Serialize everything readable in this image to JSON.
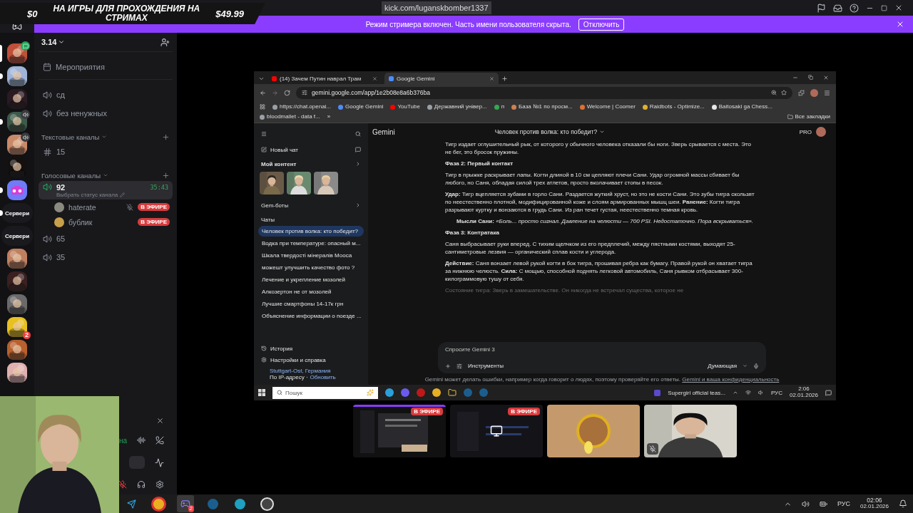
{
  "stream_overlay": {
    "left_amount": "$0",
    "title": "НА ИГРЫ ДЛЯ ПРОХОЖДЕНИЯ НА СТРИМАХ",
    "right_amount": "$49.99"
  },
  "window_url": "kick.com/luganskbomber1337",
  "streamer_banner": {
    "text": "Режим стримера включен. Часть имени пользователя скрыта.",
    "button": "Отключить"
  },
  "servers": [
    {
      "kind": "picture",
      "color": "#c0503a",
      "selected": true,
      "unread": false,
      "voice_active": false,
      "new_messages": true
    },
    {
      "kind": "picture",
      "color": "#9fb4d8",
      "selected": false,
      "unread": true,
      "voice_active": false,
      "new_messages": false
    },
    {
      "kind": "picture",
      "color": "#2a1a22",
      "selected": false,
      "unread": false,
      "voice_active": false,
      "new_messages": false
    },
    {
      "kind": "picture",
      "color": "#3d5a4a",
      "selected": false,
      "unread": true,
      "voice_active": true,
      "new_messages": false
    },
    {
      "kind": "picture",
      "color": "#c98a6a",
      "selected": false,
      "unread": false,
      "voice_active": true,
      "new_messages": false
    },
    {
      "kind": "picture",
      "color": "#151010",
      "selected": false,
      "unread": false,
      "voice_active": false,
      "new_messages": false
    },
    {
      "kind": "boombox",
      "color": "#6f7bf7",
      "selected": false,
      "unread": true,
      "voice_active": false,
      "new_messages": false
    },
    {
      "kind": "folder",
      "label": "Сервери",
      "selected": false,
      "unread": true,
      "voice_active": false,
      "new_messages": false
    },
    {
      "kind": "folder",
      "label": "Сервери",
      "selected": false,
      "unread": false,
      "voice_active": false,
      "new_messages": false
    },
    {
      "kind": "picture",
      "color": "#c08060",
      "selected": false,
      "unread": false,
      "voice_active": false,
      "new_messages": false
    },
    {
      "kind": "picture",
      "color": "#3a2020",
      "selected": false,
      "unread": false,
      "voice_active": false,
      "new_messages": false
    },
    {
      "kind": "picture",
      "color": "#6a6a6a",
      "selected": false,
      "unread": false,
      "voice_active": false,
      "new_messages": false
    },
    {
      "kind": "picture",
      "color": "#e8c020",
      "selected": false,
      "unread": false,
      "voice_active": false,
      "new_messages": false,
      "mentions": "2"
    },
    {
      "kind": "picture",
      "color": "#b8602e",
      "selected": false,
      "unread": false,
      "voice_active": false,
      "new_messages": false
    },
    {
      "kind": "picture",
      "color": "#e0b0b0",
      "selected": false,
      "unread": false,
      "voice_active": false,
      "new_messages": false
    }
  ],
  "server_name": "3.14",
  "events": "Мероприятия",
  "top_channels": [
    {
      "kind": "voice",
      "name": "сд",
      "selected": false
    },
    {
      "kind": "voice",
      "name": "без ненужных",
      "selected": false
    }
  ],
  "categories": [
    {
      "name": "Текстовые каналы",
      "channels": [
        {
          "kind": "text",
          "name": "15",
          "selected": false
        }
      ]
    },
    {
      "name": "Голосовые каналы",
      "channels": [
        {
          "kind": "voice",
          "name": "92",
          "selected": true,
          "timer": "35:43",
          "status": "Выбрать статус канала",
          "members": [
            {
              "name": "haterate",
              "muted": true,
              "live": "В ЭФИРЕ"
            },
            {
              "name": "бублик",
              "muted": false,
              "live": "В ЭФИРЕ"
            }
          ]
        },
        {
          "kind": "voice",
          "name": "65",
          "selected": false
        },
        {
          "kind": "voice",
          "name": "35",
          "selected": false
        }
      ]
    }
  ],
  "voice_panel": {
    "status_fragment": "на",
    "mic_muted": true
  },
  "browser": {
    "tabs": [
      {
        "title": "(14) Зачем Путин наврал Трам",
        "color": "#ff0000",
        "selected": false
      },
      {
        "title": "Google Gemini",
        "color": "#4e8cf7",
        "selected": true
      }
    ],
    "url": "gemini.google.com/app/1e2b08e8a6b376ba",
    "bookmarks": [
      {
        "label": "https://chat.openai...",
        "color": "#9aa0a6"
      },
      {
        "label": "Google Gemini",
        "color": "#4e8cf7"
      },
      {
        "label": "YouTube",
        "color": "#ff0000"
      },
      {
        "label": "Державний універ...",
        "color": "#9aa0a6"
      },
      {
        "label": "п",
        "color": "#34a853"
      },
      {
        "label": "База №1 по просм...",
        "color": "#d08050"
      },
      {
        "label": "Welcome | Coomer",
        "color": "#e07030"
      },
      {
        "label": "Raidbots - Optimize...",
        "color": "#e0b030"
      },
      {
        "label": "Baitosaki ga Chess...",
        "color": "#e8e8e8"
      },
      {
        "label": "bloodmallet - data f...",
        "color": "#9aa0a6"
      }
    ],
    "more_bookmarks": "»",
    "all_bookmarks": "Все закладки"
  },
  "gemini": {
    "brand": "Gemini",
    "new_chat": "Новый чат",
    "my_content": "Мой контент",
    "gems": "Gem-боты",
    "chats_heading": "Чаты",
    "chats": [
      {
        "title": "Человек против волка: кто победит?",
        "selected": true
      },
      {
        "title": "Водка при температуре: опасный м...",
        "selected": false
      },
      {
        "title": "Шкала твердості мінералів Мооса",
        "selected": false
      },
      {
        "title": "можешт улучшить качество фото ?",
        "selected": false
      },
      {
        "title": "Лечение и укрепление мозолей",
        "selected": false
      },
      {
        "title": "Алкозертон не от мозолей",
        "selected": false
      },
      {
        "title": "Лучшие смартфоны 14-17к грн",
        "selected": false
      },
      {
        "title": "Объяснение информации о поезде ...",
        "selected": false
      }
    ],
    "history": "История",
    "settings": "Настройки и справка",
    "location": {
      "place": "Stuttgart-Ost, Германия",
      "source": "По IP-адресу ·",
      "action": "Обновить"
    },
    "chat_title": "Человек против волка: кто победит?",
    "plan": "PRO",
    "blocks": [
      {
        "kind": "paragraph",
        "text": "Тигр издает оглушительный рык, от которого у обычного человека отказали бы ноги. Зверь срывается с места. Это не бег, это бросок пружины."
      },
      {
        "kind": "heading",
        "text": "Фаза 2: Первый контакт"
      },
      {
        "kind": "paragraph",
        "text": "Тигр в прыжке раскрывает лапы. Когти длиной в 10 см цепляют плечи Сани. Удар огромной массы сбивает бы любого, но Саня, обладая силой трех атлетов, просто вколачивает стопы в песок."
      },
      {
        "kind": "paragraph",
        "text": "**Удар:** Тигр вцепляется зубами в горло Сани. Раздается жуткий хруст, но это не кости Сани. Это зубы тигра скользят по неестественно плотной, модифицированной коже и слоям армированных мышц шеи. **Ранение:** Когти тигра разрывают куртку и вонзаются в грудь Сани. Из ран течет густая, неестественно темная кровь."
      },
      {
        "kind": "quote",
        "text": "**Мысли Сани:** *«Боль... просто сигнал. Давление на челюсти — 700 PSI. Недостаточно. Пора вскрываться».*"
      },
      {
        "kind": "heading",
        "text": "Фаза 3: Контратака"
      },
      {
        "kind": "paragraph",
        "text": "Саня выбрасывает руки вперед. С тихим щелчком из его предплечий, между пястными костями, выходят 25-сантиметровые лезвия — органический сплав кости и углерода."
      },
      {
        "kind": "paragraph",
        "text": "**Действие:** Саня вонзает левой рукой когти в бок тигра, прошивая ребра как бумагу. Правой рукой он хватает тигра за нижнюю челюсть. **Сила:** С мощью, способной поднять легковой автомобиль, Саня рывком отбрасывает 300-килограммовую тушу от себя."
      },
      {
        "kind": "faded",
        "text": "Состояние тигра: Зверь в замешательстве. Он никогда не встречал существа, которое не"
      }
    ],
    "input_placeholder": "Спросите Gemini 3",
    "tools": "Инструменты",
    "mode": "Думающая",
    "disclaimer": "Gemini может делать ошибки, например когда говорит о людях, поэтому проверяйте его ответы.",
    "privacy_link": "Gemini и ваша конфиденциальность"
  },
  "stream_taskbar": {
    "search_placeholder": "Пошук",
    "media": "Supergirl official teas...",
    "language": "РУС",
    "time": "2:06",
    "date": "02.01.2026"
  },
  "tiles": [
    {
      "kind": "screen",
      "live": "В ЭФИРЕ",
      "muted": false
    },
    {
      "kind": "monitor",
      "live": "В ЭФИРЕ",
      "muted": false
    },
    {
      "kind": "avatar",
      "muted": false
    },
    {
      "kind": "camera",
      "muted": true
    }
  ],
  "taskbar": {
    "badge": "2",
    "language": "РУС",
    "time": "02:06",
    "date": "02.01.2026"
  }
}
